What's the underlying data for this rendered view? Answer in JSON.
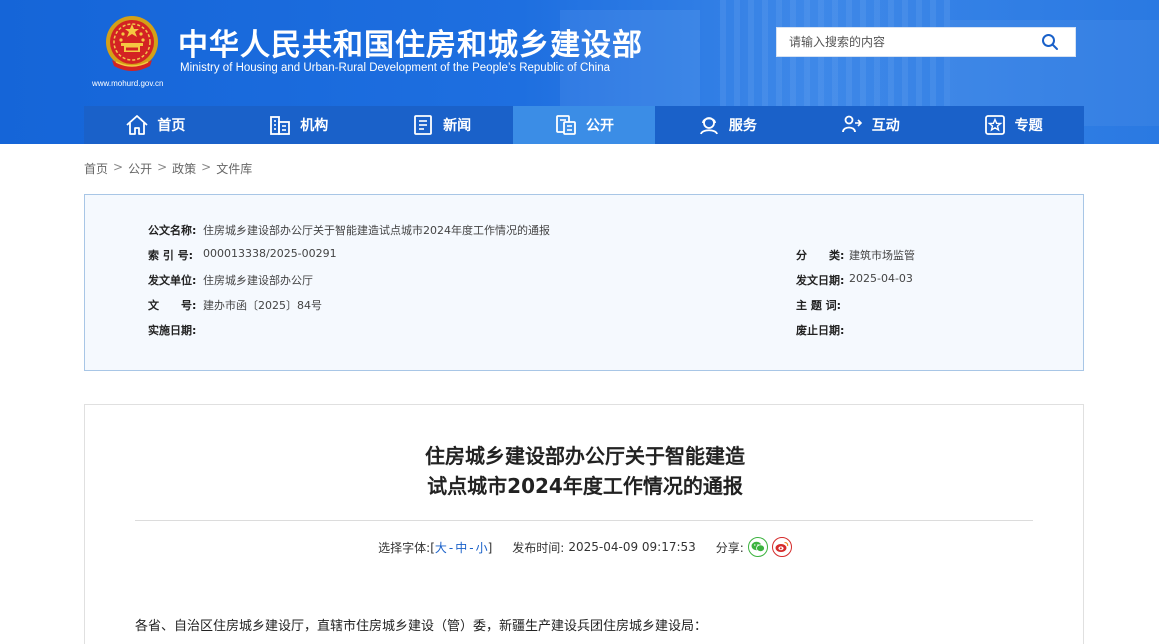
{
  "header": {
    "title": "中华人民共和国住房和城乡建设部",
    "subtitle": "Ministry of Housing and Urban-Rural Development of the People’s Republic of China",
    "url": "www.mohurd.gov.cn",
    "emblem": "national-emblem"
  },
  "search": {
    "placeholder": "请输入搜索的内容",
    "icon": "search-icon"
  },
  "nav": {
    "items": [
      {
        "label": "首页",
        "icon": "home-icon"
      },
      {
        "label": "机构",
        "icon": "building-icon"
      },
      {
        "label": "新闻",
        "icon": "news-icon"
      },
      {
        "label": "公开",
        "icon": "disclosure-icon",
        "active": true
      },
      {
        "label": "服务",
        "icon": "service-icon"
      },
      {
        "label": "互动",
        "icon": "interaction-icon"
      },
      {
        "label": "专题",
        "icon": "topic-icon"
      }
    ]
  },
  "breadcrumb": {
    "items": [
      "首页",
      "公开",
      "政策",
      "文件库"
    ],
    "separator": ">"
  },
  "info": {
    "doc_name_label": "公文名称:",
    "doc_name": "住房城乡建设部办公厅关于智能建造试点城市2024年度工作情况的通报",
    "index_label": "索 引 号:",
    "index": "000013338/2025-00291",
    "issuer_label": "发文单位:",
    "issuer": "住房城乡建设部办公厅",
    "doc_no_label": "文　　号:",
    "doc_no": "建办市函〔2025〕84号",
    "effective_label": "实施日期:",
    "effective": "",
    "category_label": "分　　类:",
    "category": "建筑市场监管",
    "issue_date_label": "发文日期:",
    "issue_date": "2025-04-03",
    "keywords_label": "主 题 词:",
    "keywords": "",
    "repeal_label": "废止日期:",
    "repeal": ""
  },
  "article": {
    "title_line1": "住房城乡建设部办公厅关于智能建造",
    "title_line2": "试点城市2024年度工作情况的通报",
    "font_size_label": "选择字体:",
    "font_open": "[",
    "font_large": "大",
    "font_medium": "中",
    "font_small": "小",
    "font_dash": "-",
    "font_close": "]",
    "publish_label": "发布时间:",
    "publish_time": "2025-04-09 09:17:53",
    "share_label": "分享:",
    "share_icons": [
      "wechat-icon",
      "weibo-icon"
    ],
    "body_first_line": "各省、自治区住房城乡建设厅，直辖市住房城乡建设（管）委，新疆生产建设兵团住房城乡建设局："
  },
  "colors": {
    "header_blue": "#1e6fe0",
    "nav_blue": "#1a61c9",
    "nav_active": "#3b8de6",
    "info_bg": "#f5f9fe",
    "info_border": "#a8c6e6"
  }
}
